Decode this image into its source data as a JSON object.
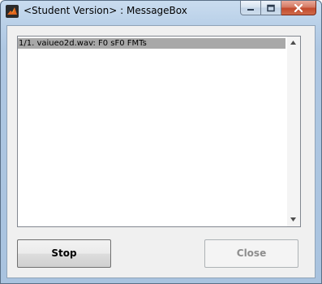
{
  "window": {
    "title": "<Student Version> : MessageBox"
  },
  "titlebar_buttons": {
    "minimize_icon": "minimize-icon",
    "maximize_icon": "maximize-icon",
    "close_icon": "close-icon"
  },
  "list": {
    "items": [
      {
        "text": "1/1. vaiueo2d.wav: F0 sF0 FMTs",
        "selected": true
      }
    ]
  },
  "buttons": {
    "stop_label": "Stop",
    "close_label": "Close",
    "close_enabled": false
  },
  "colors": {
    "selection": "#a8a8a8",
    "titlebar": "#b9d0e8",
    "close_button": "#c24a2d",
    "disabled_text": "#8d8d8d"
  }
}
